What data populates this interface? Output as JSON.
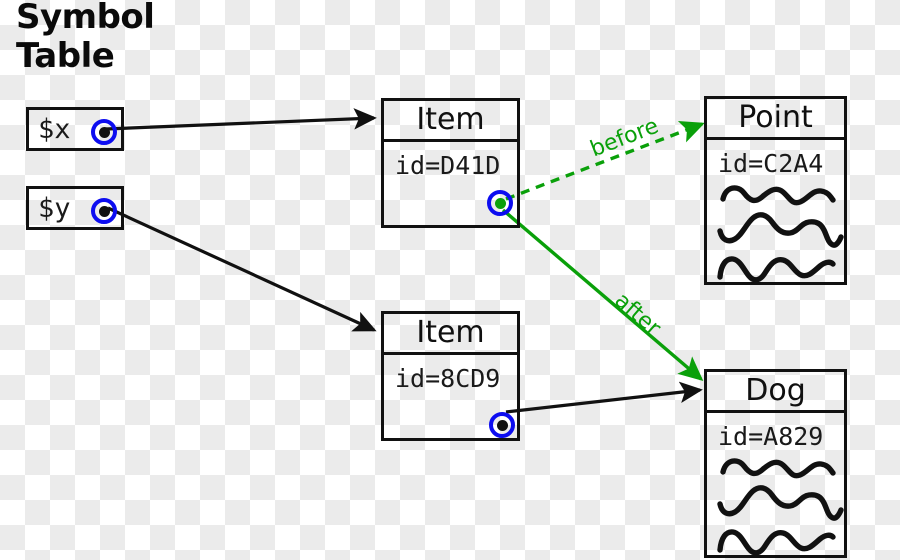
{
  "title": "Symbol Table",
  "colors": {
    "stroke": "#111111",
    "pointer_ring": "#0c0cf0",
    "pointer_dot": "#111111",
    "green": "#0aa00a",
    "background_light": "#ffffff",
    "background_dark": "#ebebeb"
  },
  "variables": [
    {
      "name": "var-x",
      "label": "$x"
    },
    {
      "name": "var-y",
      "label": "$y"
    }
  ],
  "objects": [
    {
      "name": "item-d41d",
      "title": "Item",
      "id": "id=D41D",
      "has_scribbles": false
    },
    {
      "name": "item-8cd9",
      "title": "Item",
      "id": "id=8CD9",
      "has_scribbles": false
    },
    {
      "name": "point-c2a4",
      "title": "Point",
      "id": "id=C2A4",
      "has_scribbles": true
    },
    {
      "name": "dog-a829",
      "title": "Dog",
      "id": "id=A829",
      "has_scribbles": true
    }
  ],
  "edges": [
    {
      "name": "x-to-item1",
      "label": "",
      "style": "solid",
      "color": "#111111"
    },
    {
      "name": "y-to-item2",
      "label": "",
      "style": "solid",
      "color": "#111111"
    },
    {
      "name": "item2-to-dog",
      "label": "",
      "style": "solid",
      "color": "#111111"
    },
    {
      "name": "item1-to-point",
      "label": "before",
      "style": "dashed",
      "color": "#0aa00a"
    },
    {
      "name": "item1-to-dog",
      "label": "after",
      "style": "solid",
      "color": "#0aa00a"
    }
  ],
  "labels": {
    "before": "before",
    "after": "after"
  }
}
